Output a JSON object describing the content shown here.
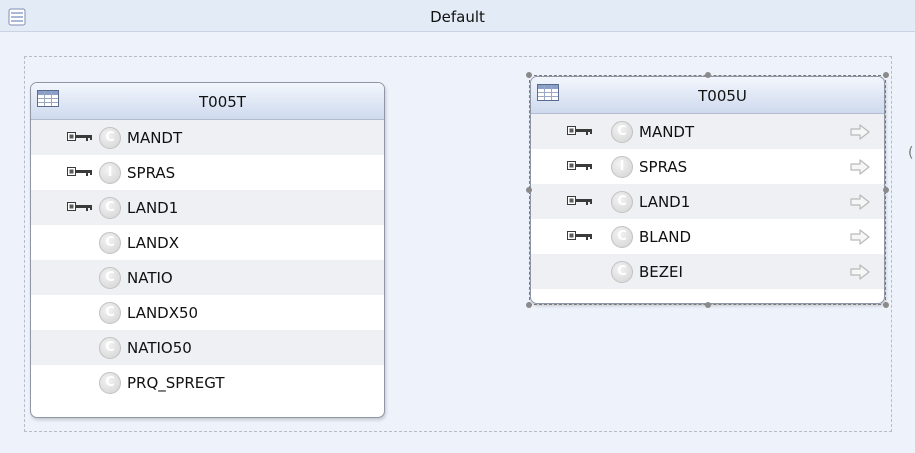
{
  "view": {
    "title": "Default"
  },
  "entities": [
    {
      "name": "T005T",
      "fields": [
        {
          "name": "MANDT",
          "key": true,
          "type_letter": "C"
        },
        {
          "name": "SPRAS",
          "key": true,
          "type_letter": "I"
        },
        {
          "name": "LAND1",
          "key": true,
          "type_letter": "C"
        },
        {
          "name": "LANDX",
          "key": false,
          "type_letter": "C"
        },
        {
          "name": "NATIO",
          "key": false,
          "type_letter": "C"
        },
        {
          "name": "LANDX50",
          "key": false,
          "type_letter": "C"
        },
        {
          "name": "NATIO50",
          "key": false,
          "type_letter": "C"
        },
        {
          "name": "PRQ_SPREGT",
          "key": false,
          "type_letter": "C"
        }
      ]
    },
    {
      "name": "T005U",
      "fields": [
        {
          "name": "MANDT",
          "key": true,
          "type_letter": "C"
        },
        {
          "name": "SPRAS",
          "key": true,
          "type_letter": "I"
        },
        {
          "name": "LAND1",
          "key": true,
          "type_letter": "C"
        },
        {
          "name": "BLAND",
          "key": true,
          "type_letter": "C"
        },
        {
          "name": "BEZEI",
          "key": false,
          "type_letter": "C"
        }
      ]
    }
  ],
  "icons": {
    "view": "view-icon",
    "table": "table-icon",
    "key": "key-icon",
    "column_type": "column-type-icon",
    "navigate": "arrow-right-icon"
  },
  "colors": {
    "canvas_bg": "#eef3fb",
    "header_top": "#f2f6fd",
    "header_bottom": "#cfdaee",
    "row_alt": "#eef0f3"
  }
}
